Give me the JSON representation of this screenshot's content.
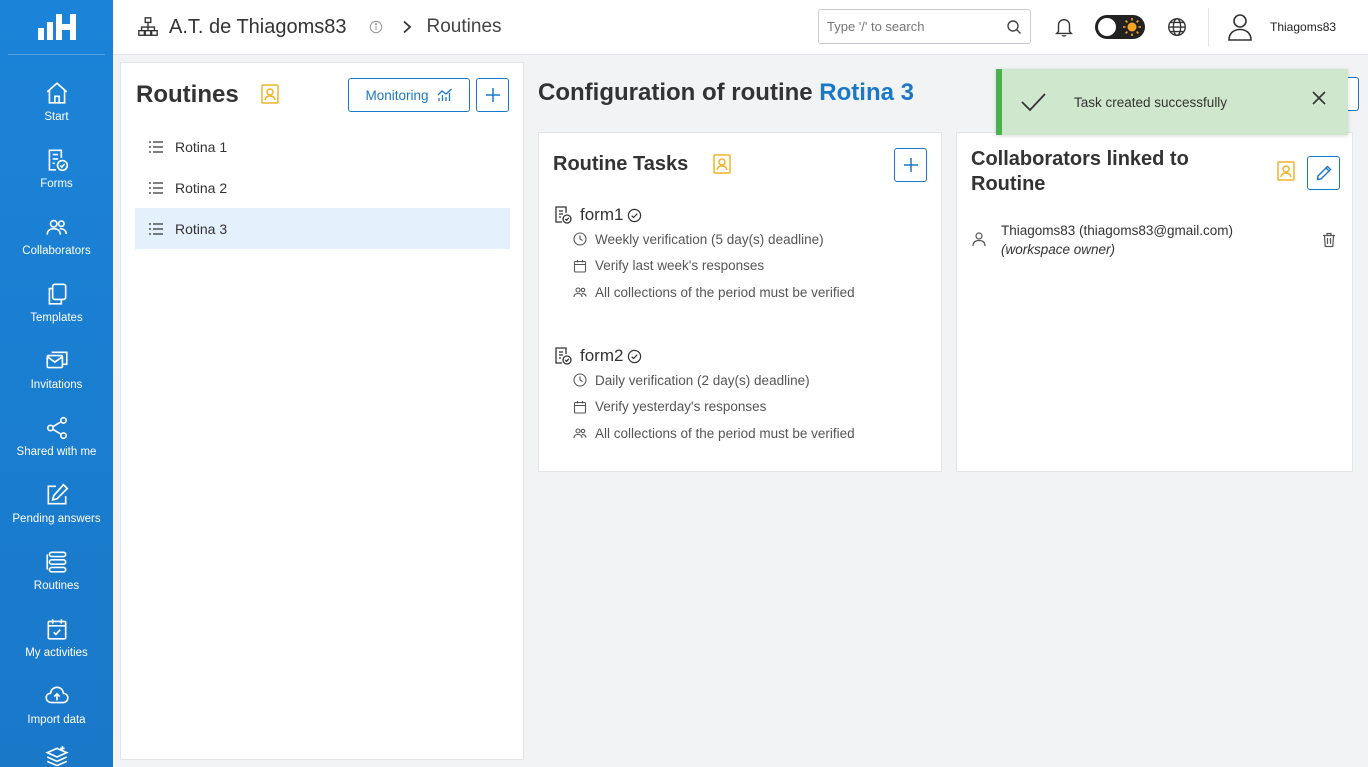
{
  "sidebar": {
    "items": [
      {
        "label": "Start",
        "icon": "home-icon"
      },
      {
        "label": "Forms",
        "icon": "form-check-icon"
      },
      {
        "label": "Collaborators",
        "icon": "users-icon"
      },
      {
        "label": "Templates",
        "icon": "copy-icon"
      },
      {
        "label": "Invitations",
        "icon": "envelope-icon"
      },
      {
        "label": "Shared with me",
        "icon": "share-icon"
      },
      {
        "label": "Pending answers",
        "icon": "edit-icon"
      },
      {
        "label": "Routines",
        "icon": "routines-icon"
      },
      {
        "label": "My activities",
        "icon": "calendar-check-icon"
      },
      {
        "label": "Import data",
        "icon": "cloud-upload-icon"
      },
      {
        "label": "",
        "icon": "layers-icon"
      }
    ]
  },
  "header": {
    "org_name": "A.T. de Thiagoms83",
    "breadcrumb_current": "Routines",
    "search_placeholder": "Type '/' to search",
    "username": "Thiagoms83"
  },
  "routines_panel": {
    "title": "Routines",
    "monitoring_label": "Monitoring",
    "items": [
      "Rotina 1",
      "Rotina 2",
      "Rotina 3"
    ],
    "active_index": 2
  },
  "config": {
    "title_prefix": "Configuration of routine",
    "routine_name": "Rotina 3"
  },
  "tasks_card": {
    "title": "Routine Tasks",
    "tasks": [
      {
        "name": "form1",
        "frequency": "Weekly verification (5 day(s) deadline)",
        "period": "Verify last week's responses",
        "collections": "All collections of the period must be verified"
      },
      {
        "name": "form2",
        "frequency": "Daily verification (2 day(s) deadline)",
        "period": "Verify yesterday's responses",
        "collections": "All collections of the period must be verified"
      }
    ]
  },
  "collab_card": {
    "title": "Collaborators linked to Routine",
    "collaborator": "Thiagoms83 (thiagoms83@gmail.com)",
    "role": "(workspace owner)"
  },
  "toast": {
    "message": "Task created successfully"
  },
  "colors": {
    "primary": "#1a78c9",
    "accent_yellow": "#f0b429",
    "toast_bg": "#cfe7cc",
    "toast_border": "#4caf50"
  }
}
